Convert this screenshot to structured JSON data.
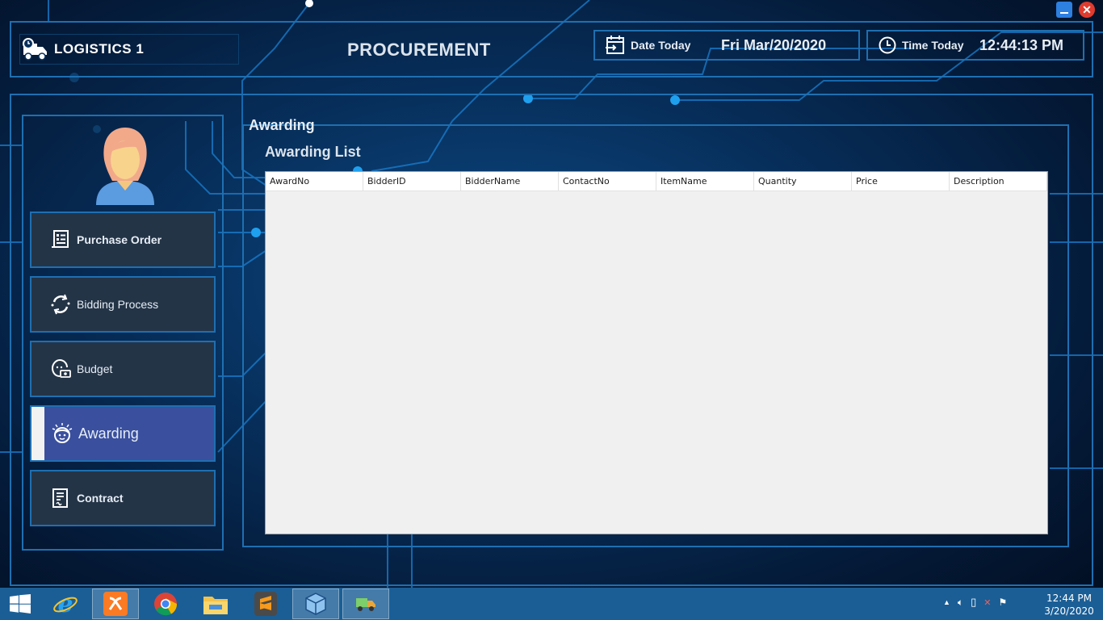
{
  "header": {
    "app_name": "LOGISTICS 1",
    "page_title": "PROCUREMENT",
    "date_label": "Date Today",
    "date_value": "Fri Mar/20/2020",
    "time_label": "Time Today",
    "time_value": "12:44:13 PM"
  },
  "sidebar": {
    "items": [
      {
        "label": "Purchase Order",
        "icon": "document-list-icon"
      },
      {
        "label": "Bidding Process",
        "icon": "refresh-cycle-icon"
      },
      {
        "label": "Budget",
        "icon": "user-money-icon"
      },
      {
        "label": "Awarding",
        "icon": "face-spark-icon",
        "active": true
      },
      {
        "label": "Contract",
        "icon": "contract-doc-icon"
      }
    ]
  },
  "main": {
    "group_title": "Awarding",
    "list_title": "Awarding List",
    "columns": [
      "AwardNo",
      "BidderID",
      "BidderName",
      "ContactNo",
      "ItemName",
      "Quantity",
      "Price",
      "Description"
    ],
    "rows": []
  },
  "taskbar": {
    "apps": [
      "internet-explorer-icon",
      "xampp-icon",
      "chrome-icon",
      "file-explorer-icon",
      "sublime-text-icon",
      "virtualbox-icon",
      "logistics-app-icon"
    ],
    "clock_time": "12:44 PM",
    "clock_date": "3/20/2020"
  },
  "colors": {
    "background": "#07305d",
    "frame_border": "#1f6fb1",
    "nav_bg": "#243447",
    "nav_active": "#3a4f9e",
    "grid_bg": "#f0f0f0",
    "taskbar": "#1b5e96"
  }
}
